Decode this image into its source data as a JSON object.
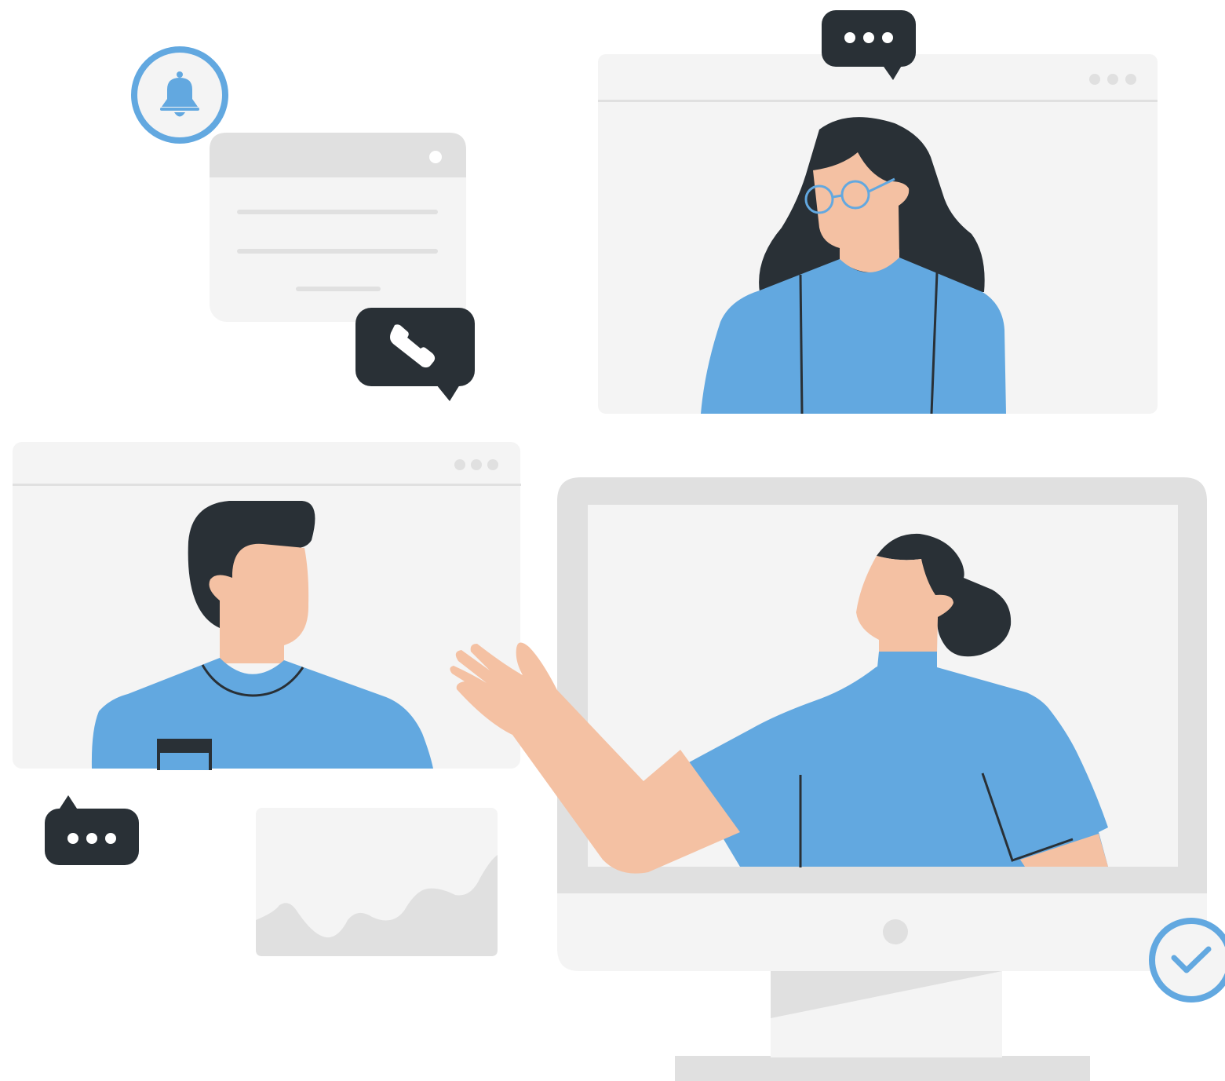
{
  "colors": {
    "background": "#ffffff",
    "panel": "#f4f4f4",
    "panel_bar": "#e0e0e0",
    "divider": "#e0e0e0",
    "dark": "#293036",
    "accent": "#62a8e0",
    "skin": "#f4c1a3",
    "white": "#ffffff"
  },
  "icons": {
    "notification": "bell-icon",
    "phone_bubble": "phone-icon",
    "typing_bubble": "ellipsis-icon",
    "confirmation": "checkmark-icon",
    "window_controls": "three-dots-icon"
  },
  "scene": {
    "windows": [
      "video-call-window-top",
      "video-call-window-left",
      "notification-dialog",
      "area-chart-card"
    ],
    "participants": [
      "woman-with-glasses",
      "man-short-hair",
      "presenter-woman-waving"
    ],
    "device": "desktop-monitor"
  }
}
